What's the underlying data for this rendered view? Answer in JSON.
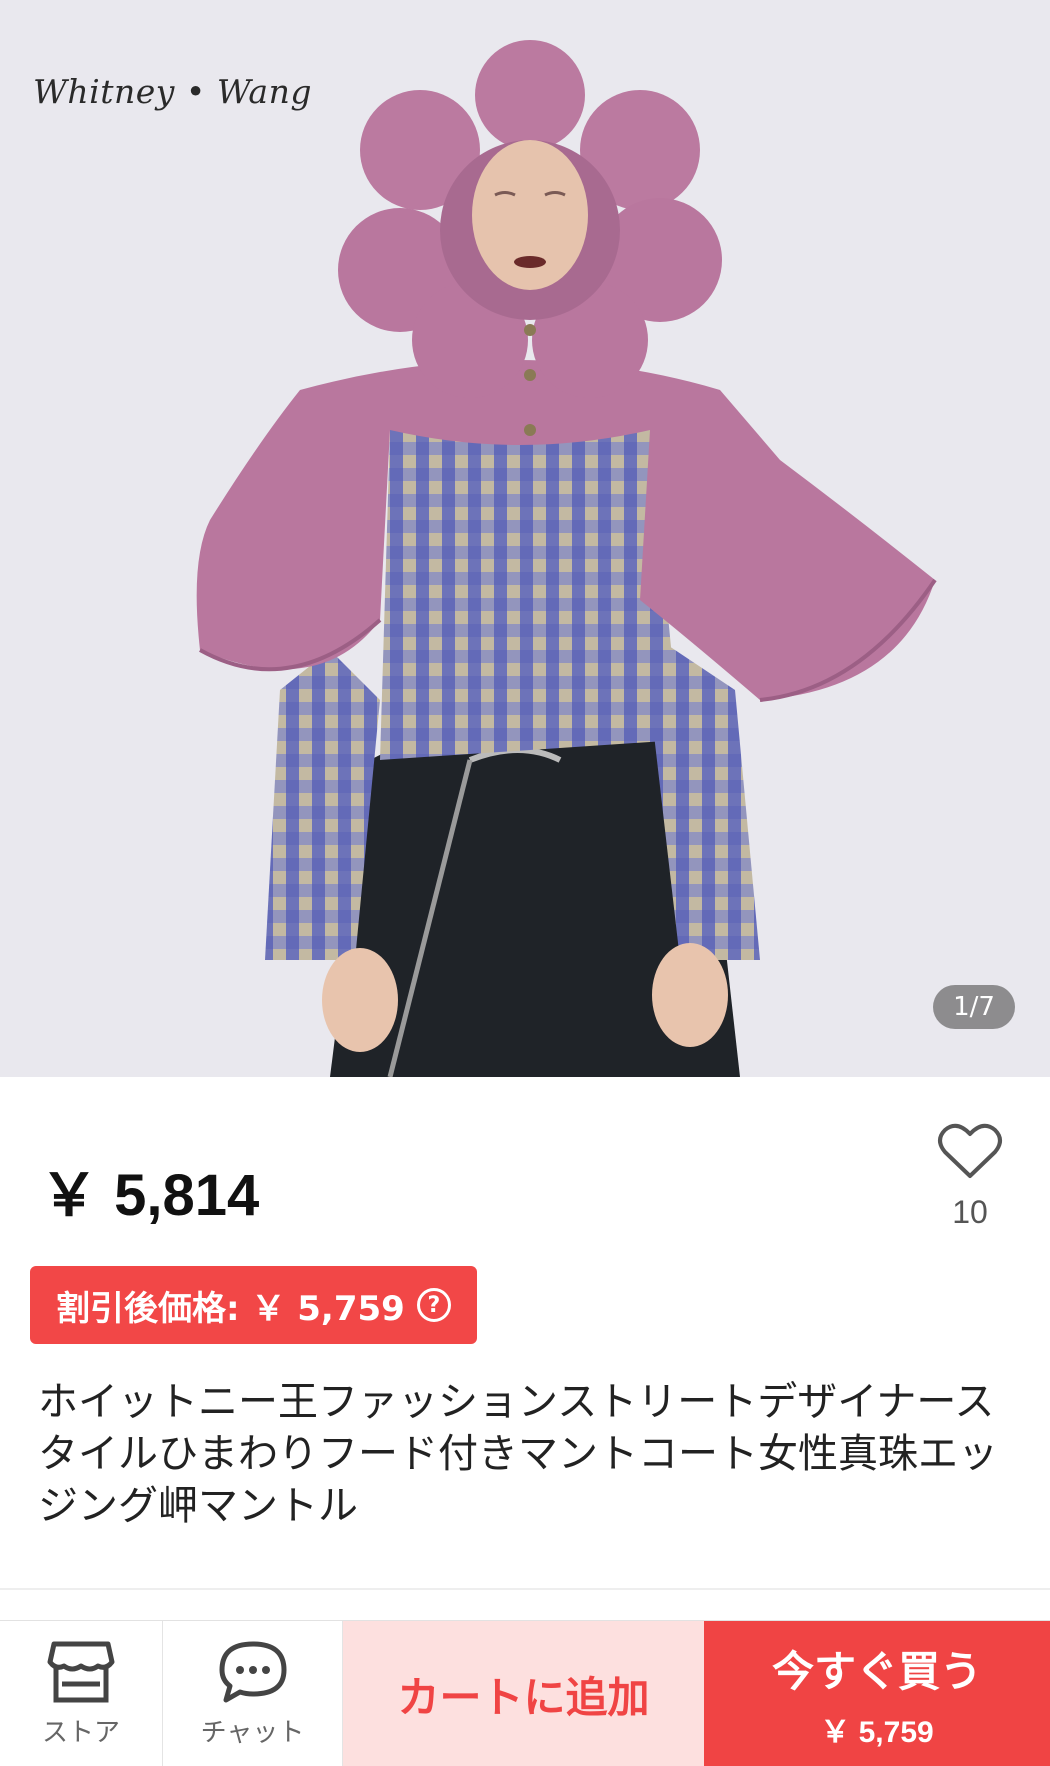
{
  "gallery": {
    "brand_logo": "Whitney • Wang",
    "counter": "1/7",
    "colors": {
      "background": "#e9e8ee",
      "cape": "#b9779e",
      "gingham": "#5a63b8",
      "skirt": "#1f2328"
    }
  },
  "product": {
    "price": "￥ 5,814",
    "favorite_count": "10",
    "discount_label": "割引後価格: ￥ 5,759",
    "help_icon": "?",
    "title": "ホイットニー王ファッションストリートデザイナースタイルひまわりフード付きマントコート女性真珠エッジング岬マントル"
  },
  "bottom_bar": {
    "store_label": "ストア",
    "chat_label": "チャット",
    "cart_label": "カートに追加",
    "buy_label": "今すぐ買う",
    "buy_price": "￥ 5,759"
  },
  "colors": {
    "accent": "#f04444",
    "cart_bg": "#fde0df"
  }
}
